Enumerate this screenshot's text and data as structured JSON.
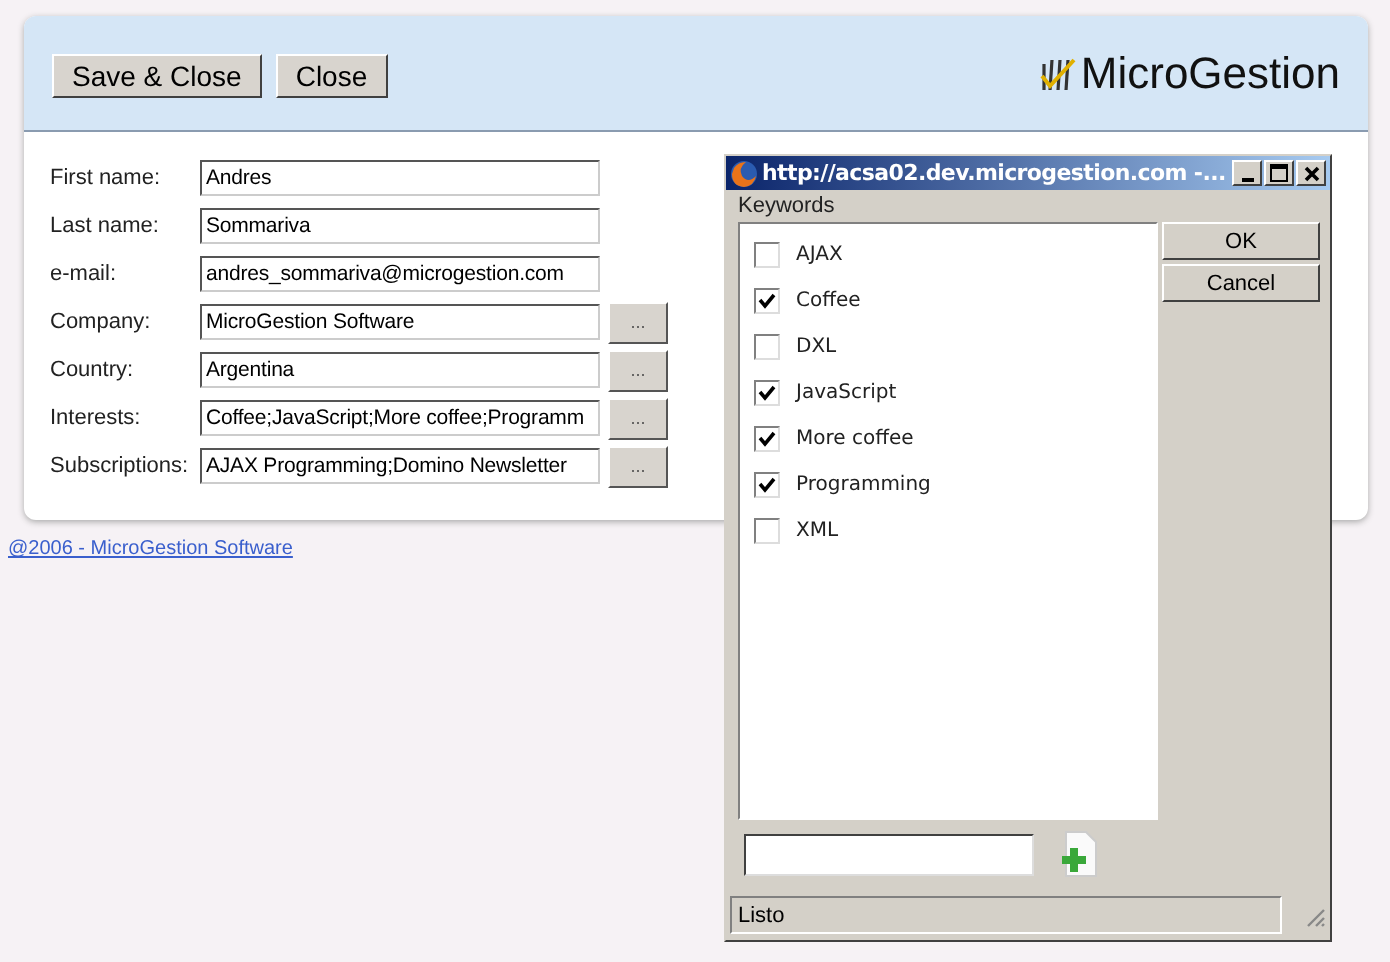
{
  "toolbar": {
    "buttons": [
      "Save & Close",
      "Close"
    ],
    "logo": "MicroGestion"
  },
  "form": [
    {
      "label": "First name:",
      "value": "Andres"
    },
    {
      "label": "Last name:",
      "value": "Sommariva"
    },
    {
      "label": "e-mail:",
      "value": "andres_sommariva@microgestion.com"
    },
    {
      "label": "Company:",
      "value": "MicroGestion Software",
      "picker": "..."
    },
    {
      "label": "Country:",
      "value": "Argentina",
      "picker": "..."
    },
    {
      "label": "Interests:",
      "value": "Coffee;JavaScript;More coffee;Programm",
      "picker": "..."
    },
    {
      "label": "Subscriptions:",
      "value": "AJAX Programming;Domino Newsletter",
      "picker": "..."
    }
  ],
  "footer_link": "@2006 - MicroGestion Software",
  "popup": {
    "title": "http://acsa02.dev.microgestion.com -...",
    "list_label": "Keywords",
    "keywords": [
      {
        "label": "AJAX",
        "checked": false
      },
      {
        "label": "Coffee",
        "checked": true
      },
      {
        "label": "DXL",
        "checked": false
      },
      {
        "label": "JavaScript",
        "checked": true
      },
      {
        "label": "More coffee",
        "checked": true
      },
      {
        "label": "Programming",
        "checked": true
      },
      {
        "label": "XML",
        "checked": false
      }
    ],
    "buttons": [
      "OK",
      "Cancel"
    ],
    "status": "Listo"
  }
}
